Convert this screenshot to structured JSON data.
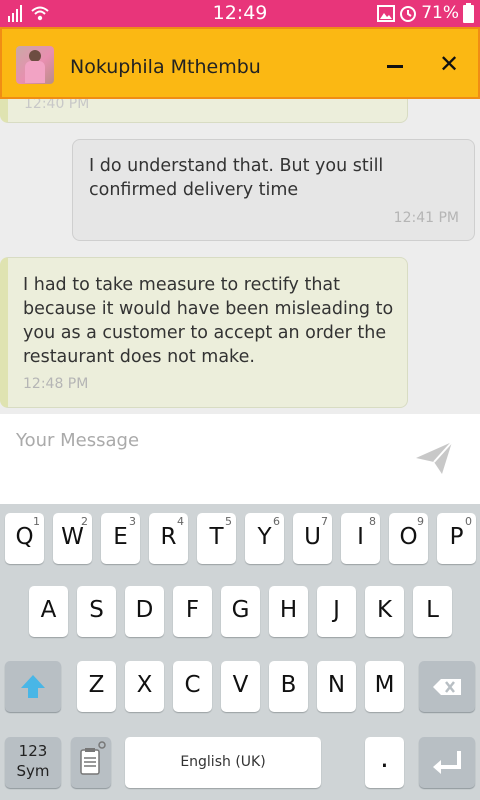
{
  "status_bar": {
    "time": "12:49",
    "battery": "71%"
  },
  "header": {
    "contact_name": "Nokuphila Mthembu",
    "close_label": "✕"
  },
  "messages": [
    {
      "side": "in",
      "text": "",
      "time": "12:40 PM"
    },
    {
      "side": "out",
      "text": "I do understand that. But you still confirmed delivery time",
      "time": "12:41 PM"
    },
    {
      "side": "in",
      "text": "I had to take measure to rectify that because it would have been misleading to you as a customer to accept an order the restaurant does not make.",
      "time": "12:48 PM"
    }
  ],
  "composer": {
    "placeholder": "Your Message"
  },
  "keyboard": {
    "row1": [
      {
        "ch": "Q",
        "num": "1"
      },
      {
        "ch": "W",
        "num": "2"
      },
      {
        "ch": "E",
        "num": "3"
      },
      {
        "ch": "R",
        "num": "4"
      },
      {
        "ch": "T",
        "num": "5"
      },
      {
        "ch": "Y",
        "num": "6"
      },
      {
        "ch": "U",
        "num": "7"
      },
      {
        "ch": "I",
        "num": "8"
      },
      {
        "ch": "O",
        "num": "9"
      },
      {
        "ch": "P",
        "num": "0"
      }
    ],
    "row2": [
      "A",
      "S",
      "D",
      "F",
      "G",
      "H",
      "J",
      "K",
      "L"
    ],
    "row3": [
      "Z",
      "X",
      "C",
      "V",
      "B",
      "N",
      "M"
    ],
    "sym_label_1": "123",
    "sym_label_2": "Sym",
    "space_label": "English (UK)",
    "period_label": "."
  },
  "colors": {
    "status_bar": "#e8357a",
    "header": "#fbb813",
    "incoming_bubble": "#eceedb",
    "outgoing_bubble": "#e6e6e6"
  },
  "icons": [
    "signal-icon",
    "wifi-icon",
    "image-icon",
    "alarm-icon",
    "battery-icon",
    "avatar",
    "minimize-icon",
    "close-icon",
    "send-icon",
    "shift-icon",
    "backspace-icon",
    "clipboard-icon",
    "enter-icon"
  ]
}
